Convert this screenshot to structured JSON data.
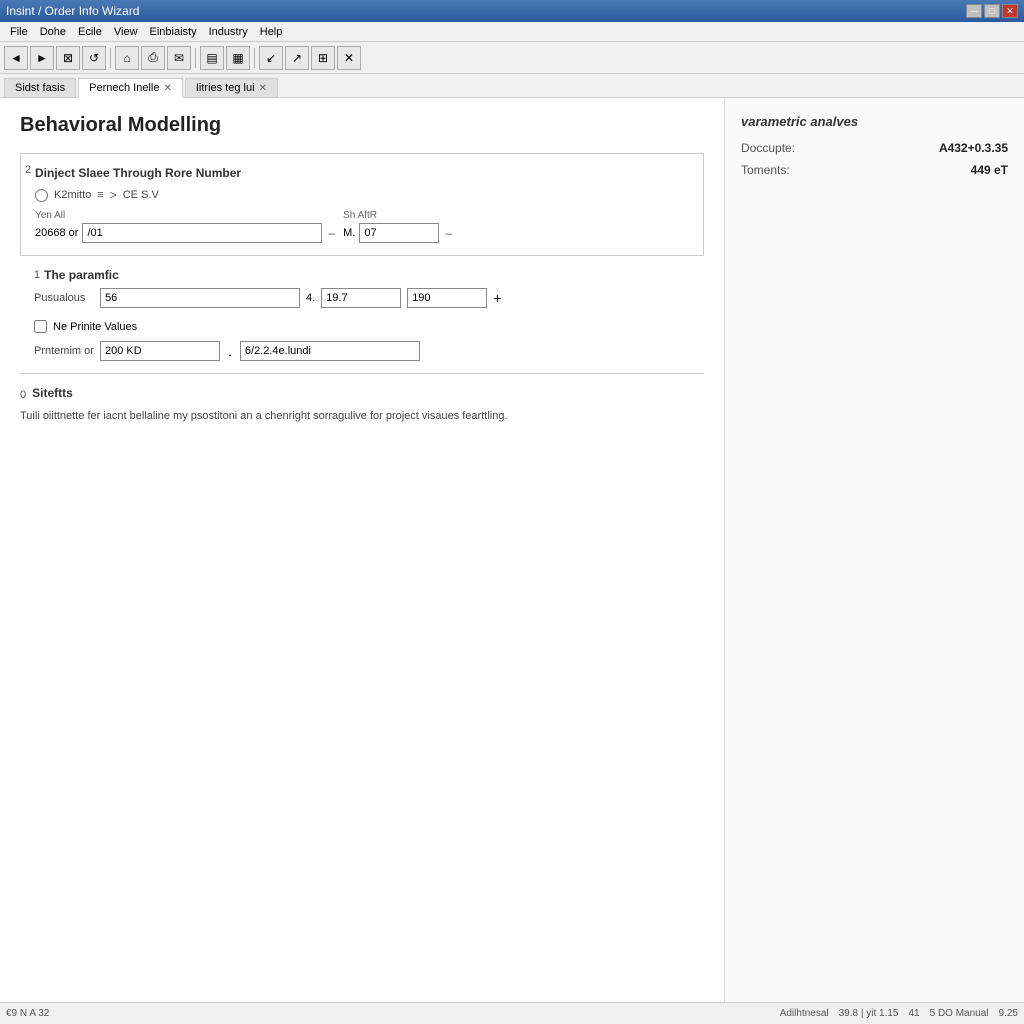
{
  "titleBar": {
    "text": "Insint / Order Info Wizard",
    "controls": [
      "minimize",
      "restore",
      "close"
    ]
  },
  "menuBar": {
    "items": [
      "File",
      "Dohe",
      "Ecile",
      "View",
      "Einbiaisty",
      "Industry",
      "Help"
    ]
  },
  "toolbar": {
    "buttons": [
      "◄",
      "►",
      "⊠",
      "◉",
      "↺",
      "↻",
      "⊡",
      "▤",
      "▦",
      "↙",
      "↗",
      "⊞",
      "✕"
    ]
  },
  "tabs": [
    {
      "label": "Sidst fasis",
      "active": false,
      "closable": false
    },
    {
      "label": "Pernech Inelle",
      "active": true,
      "closable": true
    },
    {
      "label": "Iitries teg lui",
      "active": false,
      "closable": true
    }
  ],
  "main": {
    "title": "Behavioral Modelling",
    "sections": [
      {
        "number": "2",
        "title": "Dinject Slaee Through Rore Number",
        "radio": {
          "label": "K2mitto",
          "navIcon": "≡",
          "arrow": ">",
          "rightLabel": "CE S.V"
        },
        "fromLabel": "Yen All",
        "fromValue": "20668 or",
        "inputFrom": "/01",
        "dash": "–",
        "toLabel": "Sh AftR",
        "toPrefix": "M.",
        "inputTo": "07",
        "toDash": "–"
      },
      {
        "number": "1",
        "title": "The paramfic",
        "label": "Pusualous",
        "value1": "56",
        "sep": "4.",
        "value2": "19.7",
        "value3": "190",
        "plusIcon": "+"
      },
      {
        "number": "",
        "checkbox": "Ne Prinite Values",
        "premLabel": "Prntemim or",
        "premValue": "200 KD",
        "dot": ".",
        "premValue2": "6/2.2.4e.lundi"
      }
    ],
    "divider": true,
    "benefits": {
      "number": "0",
      "title": "Siteftts",
      "text": "Tuili oiittnette fer iacnt bellaline my psostitoni an a chenright sorragulive for project visaues fearttling."
    }
  },
  "rightPanel": {
    "title": "varametric analves",
    "rows": [
      {
        "label": "Doccupte:",
        "value": "A432+0.3.35"
      },
      {
        "label": "Toments:",
        "value": "449 eT"
      }
    ]
  },
  "statusBar": {
    "left": [
      "€9 N A 32"
    ],
    "right": [
      "Adilhtnesal",
      "39.8 | yit 1.15",
      "41",
      "5 DO Manual",
      "9.25"
    ]
  }
}
